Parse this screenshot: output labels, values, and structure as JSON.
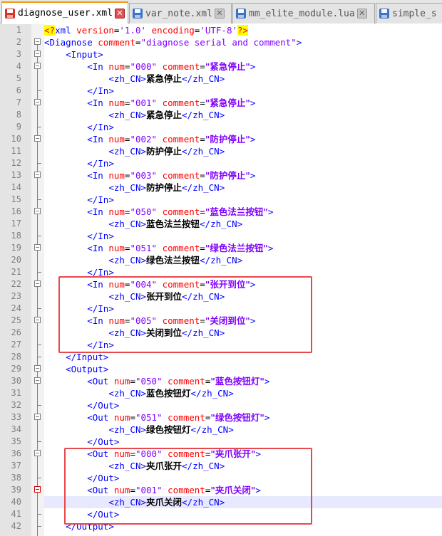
{
  "tabs": [
    {
      "label": "diagnose_user.xml",
      "active": true,
      "icon": "disk-icon-red"
    },
    {
      "label": "var_note.xml",
      "active": false,
      "icon": "disk-icon-blue"
    },
    {
      "label": "mm_elite_module.lua",
      "active": false,
      "icon": "disk-icon-blue"
    },
    {
      "label": "simple_s",
      "active": false,
      "icon": "disk-icon-blue"
    }
  ],
  "code": {
    "l1": {
      "pi_open": "<?",
      "tag": "xml",
      "attr1": "version",
      "eq1": "=",
      "val1": "'1.0'",
      "attr2": "encoding",
      "eq2": "=",
      "val2": "'UTF-8'",
      "pi_close": "?>"
    },
    "l2": {
      "tag": "<Diagnose",
      "attr": "comment",
      "eq": "=",
      "val": "\"diagnose serial and comment\"",
      "close": ">"
    },
    "l3": {
      "tag": "<Input>"
    },
    "in_open": "<In",
    "in_close": "</In>",
    "num_attr": "num",
    "comment_attr": "comment",
    "eq": "=",
    "gt": ">",
    "zh_open": "<zh_CN>",
    "zh_close": "</zh_CN>",
    "items_in": [
      {
        "num": "\"000\"",
        "comment": "\"紧急停止\"",
        "text": "紧急停止"
      },
      {
        "num": "\"001\"",
        "comment": "\"紧急停止\"",
        "text": "紧急停止"
      },
      {
        "num": "\"002\"",
        "comment": "\"防护停止\"",
        "text": "防护停止"
      },
      {
        "num": "\"003\"",
        "comment": "\"防护停止\"",
        "text": "防护停止"
      },
      {
        "num": "\"050\"",
        "comment": "\"蓝色法兰按钮\"",
        "text": "蓝色法兰按钮"
      },
      {
        "num": "\"051\"",
        "comment": "\"绿色法兰按钮\"",
        "text": "绿色法兰按钮"
      },
      {
        "num": "\"004\"",
        "comment": "\"张开到位\"",
        "text": "张开到位"
      },
      {
        "num": "\"005\"",
        "comment": "\"关闭到位\"",
        "text": "关闭到位"
      }
    ],
    "input_close": "</Input>",
    "output_open": "<Output>",
    "out_open": "<Out",
    "out_close": "</Out>",
    "items_out": [
      {
        "num": "\"050\"",
        "comment": "\"蓝色按钮灯\"",
        "text": "蓝色按钮灯"
      },
      {
        "num": "\"051\"",
        "comment": "\"绿色按钮灯\"",
        "text": "绿色按钮灯"
      },
      {
        "num": "\"000\"",
        "comment": "\"夹爪张开\"",
        "text": "夹爪张开"
      },
      {
        "num": "\"001\"",
        "comment": "\"夹爪关闭\"",
        "text": "夹爪关闭"
      }
    ],
    "output_close": "</Output>"
  },
  "line_numbers": [
    "1",
    "2",
    "3",
    "4",
    "5",
    "6",
    "7",
    "8",
    "9",
    "10",
    "11",
    "12",
    "13",
    "14",
    "15",
    "16",
    "17",
    "18",
    "19",
    "20",
    "21",
    "22",
    "23",
    "24",
    "25",
    "26",
    "27",
    "28",
    "29",
    "30",
    "31",
    "32",
    "33",
    "34",
    "35",
    "36",
    "37",
    "38",
    "39",
    "40",
    "41",
    "42"
  ],
  "colors": {
    "tag": "#0000ff",
    "attr": "#ff0000",
    "value": "#8000ff",
    "highlight_box": "#e8474b",
    "active_tab_accent": "#f39c12"
  }
}
